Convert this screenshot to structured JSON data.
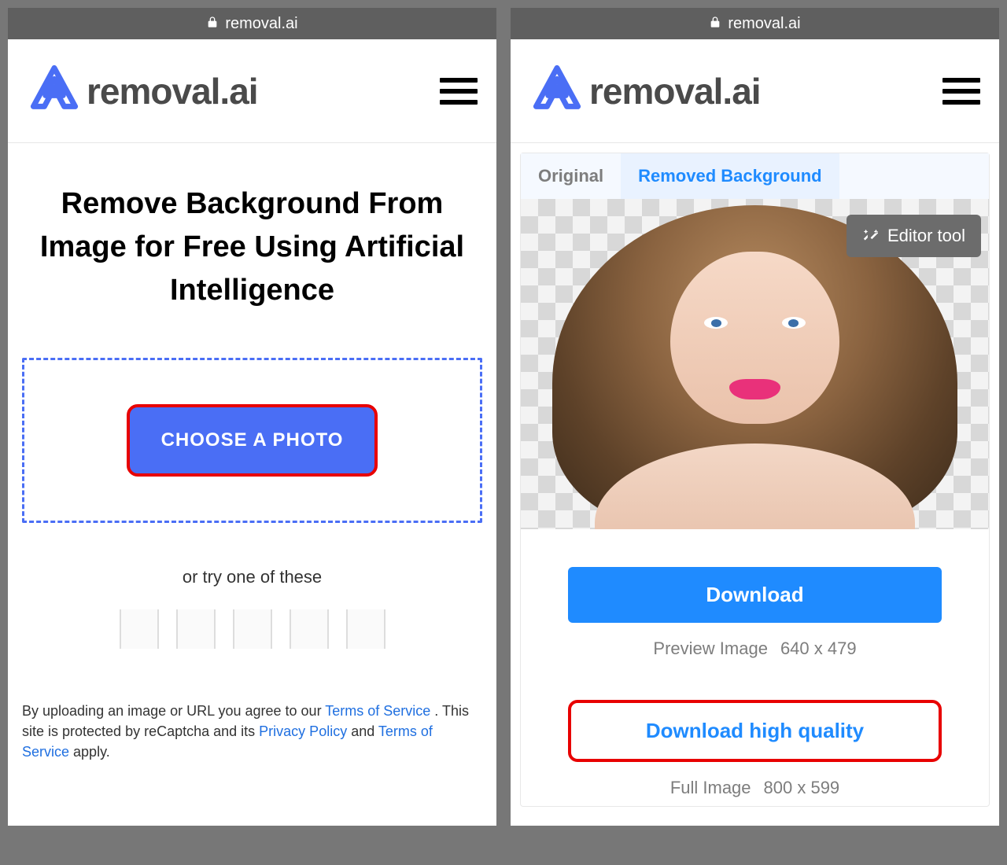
{
  "address_bar": {
    "domain": "removal.ai"
  },
  "header": {
    "brand": "removal.ai"
  },
  "left": {
    "headline": "Remove Background From Image for Free Using Artificial Intelligence",
    "choose_label": "CHOOSE A PHOTO",
    "try_label": "or try one of these",
    "legal_pre": "By uploading an image or URL you agree to our ",
    "tos": "Terms of Service",
    "legal_mid1": " . This site is protected by reCaptcha and its ",
    "privacy": "Privacy Policy",
    "legal_mid2": " and ",
    "tos2": "Terms of Service",
    "legal_post": " apply."
  },
  "right": {
    "tab_original": "Original",
    "tab_removed": "Removed Background",
    "editor_label": "Editor tool",
    "download_label": "Download",
    "preview_text": "Preview Image",
    "preview_size": "640 x 479",
    "hq_label": "Download high quality",
    "full_text": "Full Image",
    "full_size": "800 x 599"
  }
}
